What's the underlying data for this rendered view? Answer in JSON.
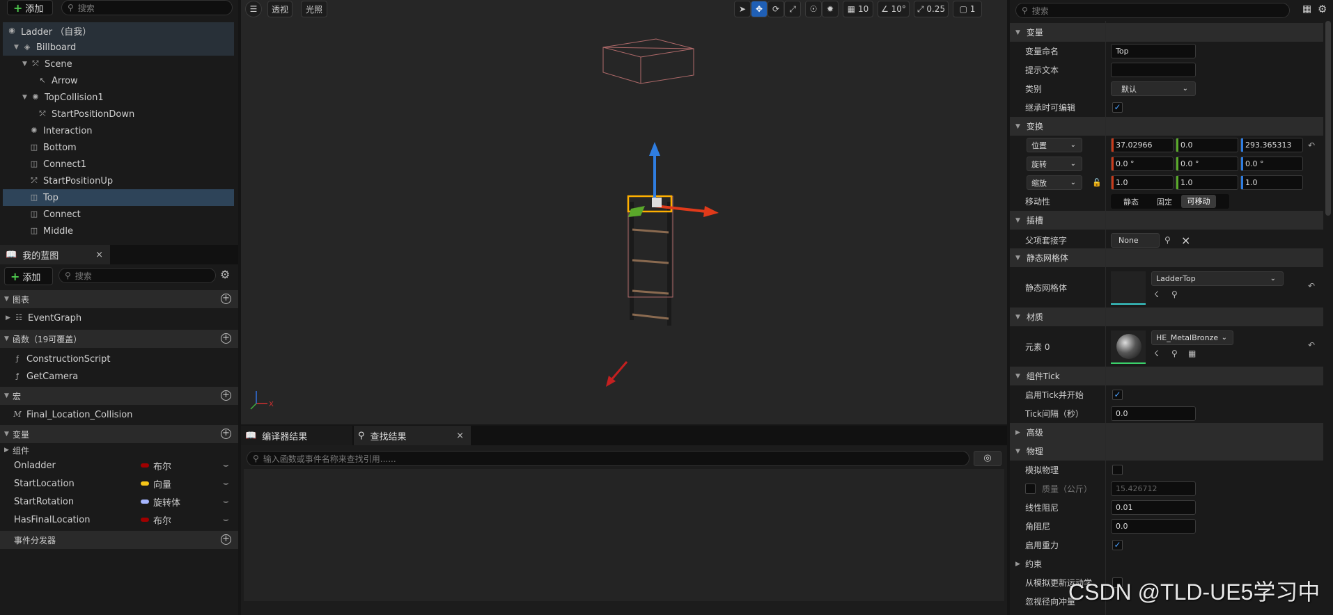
{
  "left": {
    "add_label": "添加",
    "search_placeholder": "搜索",
    "components": [
      {
        "label": "Ladder （自我）",
        "icon": "actor-icon"
      },
      {
        "label": "Billboard",
        "icon": "billboard-icon"
      },
      {
        "label": "Scene",
        "icon": "scene-icon"
      },
      {
        "label": "Arrow",
        "icon": "arrow-icon"
      },
      {
        "label": "TopCollision1",
        "icon": "collision-icon"
      },
      {
        "label": "StartPositionDown",
        "icon": "scene-icon"
      },
      {
        "label": "Interaction",
        "icon": "collision-icon"
      },
      {
        "label": "Bottom",
        "icon": "mesh-icon"
      },
      {
        "label": "Connect1",
        "icon": "mesh-icon"
      },
      {
        "label": "StartPositionUp",
        "icon": "scene-icon"
      },
      {
        "label": "Top",
        "icon": "mesh-icon"
      },
      {
        "label": "Connect",
        "icon": "mesh-icon"
      },
      {
        "label": "Middle",
        "icon": "mesh-icon"
      }
    ],
    "my_blueprint_tab": "我的蓝图",
    "bp_add_label": "添加",
    "bp_search_placeholder": "搜索",
    "graphs_header": "图表",
    "graphs": [
      "EventGraph"
    ],
    "functions_header": "函数（19可覆盖）",
    "functions": [
      "ConstructionScript",
      "GetCamera"
    ],
    "macros_header": "宏",
    "macros": [
      "Final_Location_Collision"
    ],
    "variables_header": "变量",
    "components_group": "组件",
    "variables": [
      {
        "name": "Onladder",
        "type": "布尔",
        "color": "#a00000"
      },
      {
        "name": "StartLocation",
        "type": "向量",
        "color": "#f5c518"
      },
      {
        "name": "StartRotation",
        "type": "旋转体",
        "color": "#a6b6ff"
      },
      {
        "name": "HasFinalLocation",
        "type": "布尔",
        "color": "#a00000"
      }
    ],
    "dispatchers_header": "事件分发器"
  },
  "viewport": {
    "perspective": "透视",
    "lighting": "光照",
    "grid_snap": "10",
    "rotation_snap": "10°",
    "scale_snap": "0.25",
    "camera_speed": "1"
  },
  "bottom": {
    "tab_compiler": "编译器结果",
    "tab_find": "查找结果",
    "find_placeholder": "输入函数或事件名称来查找引用......"
  },
  "details": {
    "search_placeholder": "搜索",
    "variable_section": "变量",
    "var_name_label": "变量命名",
    "var_name_value": "Top",
    "tooltip_label": "提示文本",
    "category_label": "类别",
    "category_value": "默认",
    "editable_label": "继承时可编辑",
    "transform_section": "变换",
    "location_label": "位置",
    "location": [
      "37.02966",
      "0.0",
      "293.365313"
    ],
    "rotation_label": "旋转",
    "rotation": [
      "0.0 °",
      "0.0 °",
      "0.0 °"
    ],
    "scale_label": "缩放",
    "scale": [
      "1.0",
      "1.0",
      "1.0"
    ],
    "mobility_label": "移动性",
    "mobility_options": [
      "静态",
      "固定",
      "可移动"
    ],
    "socket_section": "插槽",
    "parent_socket_label": "父项套接字",
    "parent_socket_value": "None",
    "static_mesh_section": "静态网格体",
    "static_mesh_label": "静态网格体",
    "static_mesh_value": "LadderTop",
    "materials_section": "材质",
    "element0_label": "元素 0",
    "material_value": "HE_MetalBronze",
    "tick_section": "组件Tick",
    "tick_start_label": "启用Tick并开始",
    "tick_interval_label": "Tick间隔（秒）",
    "tick_interval_value": "0.0",
    "advanced_section": "高级",
    "physics_section": "物理",
    "simulate_label": "模拟物理",
    "mass_label": "质量（公斤）",
    "mass_value": "15.426712",
    "linear_damping_label": "线性阻尼",
    "linear_damping_value": "0.01",
    "angular_damping_label": "角阻尼",
    "angular_damping_value": "0.0",
    "gravity_label": "启用重力",
    "constraints_section": "约束",
    "sim_update_label": "从模拟更新运动学",
    "ignore_radial_label": "忽视径向冲量"
  },
  "watermark": "CSDN @TLD-UE5学习中"
}
